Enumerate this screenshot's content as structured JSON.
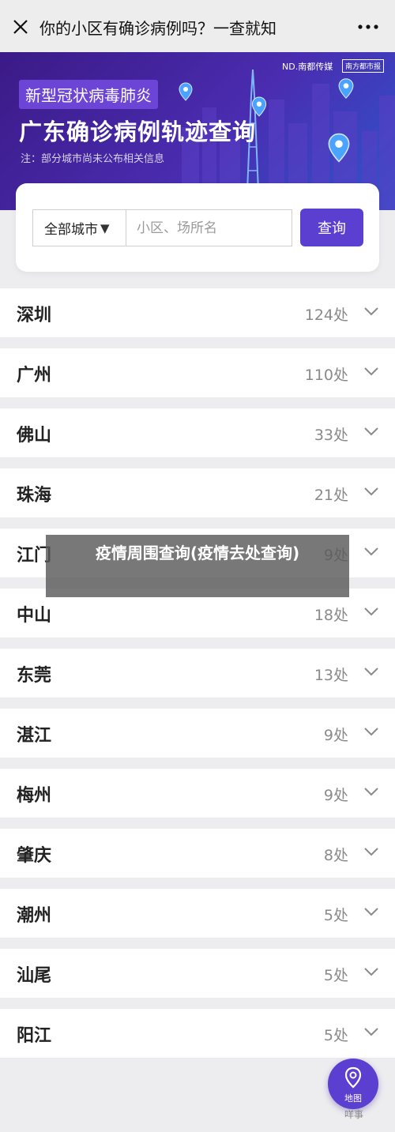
{
  "header": {
    "title": "你的小区有确诊病例吗？一查就知",
    "close_icon": "close-icon",
    "more_icon": "more-icon"
  },
  "banner": {
    "tag": "新型冠状病毒肺炎",
    "headline": "广东确诊病例轨迹查询",
    "note": "注：部分城市尚未公布相关信息",
    "brand_primary": "ND.南都传媒",
    "brand_secondary": "南方都市报"
  },
  "search": {
    "city_select": "全部城市",
    "placeholder": "小区、场所名",
    "value": "",
    "button": "查询"
  },
  "cities": [
    {
      "name": "深圳",
      "count": "124处"
    },
    {
      "name": "广州",
      "count": "110处"
    },
    {
      "name": "佛山",
      "count": "33处"
    },
    {
      "name": "珠海",
      "count": "21处"
    },
    {
      "name": "江门",
      "count": "9处"
    },
    {
      "name": "中山",
      "count": "18处"
    },
    {
      "name": "东莞",
      "count": "13处"
    },
    {
      "name": "湛江",
      "count": "9处"
    },
    {
      "name": "梅州",
      "count": "9处"
    },
    {
      "name": "肇庆",
      "count": "8处"
    },
    {
      "name": "潮州",
      "count": "5处"
    },
    {
      "name": "汕尾",
      "count": "5处"
    },
    {
      "name": "阳江",
      "count": "5处"
    }
  ],
  "overlay_caption": "疫情周围查询(疫情去处查询)",
  "map_button": {
    "label": "地图",
    "icon": "map-pin-icon"
  },
  "watermark": "咩事",
  "colors": {
    "accent": "#5b3fd0",
    "banner_start": "#3b1a86",
    "banner_end": "#2e56cc",
    "tag_bg": "#6d45d6"
  }
}
